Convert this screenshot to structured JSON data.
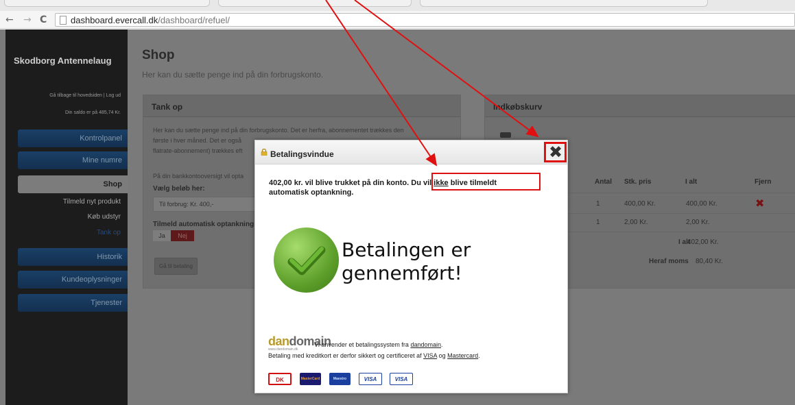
{
  "browser": {
    "url_host": "dashboard.evercall.dk",
    "url_path": "/dashboard/refuel/"
  },
  "sidebar": {
    "site_title": "Skodborg Antennelaug",
    "top_links": "Gå tilbage til hovedsiden | Log ud",
    "balance": "Din saldo er på 485,74 Kr.",
    "items": [
      {
        "label": "Kontrolpanel"
      },
      {
        "label": "Mine numre"
      },
      {
        "label": "Shop"
      },
      {
        "label": "Tilmeld nyt produkt"
      },
      {
        "label": "Køb udstyr"
      },
      {
        "label": "Tank op"
      },
      {
        "label": "Historik"
      },
      {
        "label": "Kundeoplysninger"
      },
      {
        "label": "Tjenester"
      }
    ]
  },
  "main": {
    "title": "Shop",
    "subtitle": "Her kan du sætte penge ind på din forbrugskonto."
  },
  "tank_panel": {
    "title": "Tank op",
    "text_lines": [
      "Her kan du sætte penge ind på din forbrugskonto. Det er herfra, abonnementet trækkes den",
      "første i hver måned. Det er også",
      "flatrate-abonnement) trækkes eft"
    ],
    "bank_text": "På din bankkontooversigt vil opta",
    "amount_label": "Vælg beløb her:",
    "amount_value": "Til forbrug: Kr. 400,-",
    "auto_label": "Tilmeld automatisk optankning",
    "toggle_yes": "Ja",
    "toggle_no": "Nej",
    "pay_button": "Gå til betaling"
  },
  "cart_panel": {
    "title": "Indkøbskurv",
    "columns": [
      "Antal",
      "Stk. pris",
      "I alt",
      "Fjern"
    ],
    "rows": [
      {
        "qty": "1",
        "price": "400,00 Kr.",
        "total": "400,00 Kr."
      },
      {
        "qty": "1",
        "price": "2,00 Kr.",
        "total": "2,00 Kr."
      }
    ],
    "total_label": "I alt",
    "total_value": "402,00 Kr.",
    "vat_label": "Heraf moms",
    "vat_value": "80,40 Kr."
  },
  "modal": {
    "title": "Betalingsvindue",
    "message_part1": "402,00 kr. vil blive trukket på din konto.",
    "message_part2": "Du vil",
    "message_ikke": "ikke",
    "message_part3": "blive tilmeldt",
    "message_line2": "automatisk optankning.",
    "success_line1": "Betalingen er",
    "success_line2": "gennemført!",
    "logo_dan": "dan",
    "logo_domain": "domain",
    "logo_url": "www.dandomain.dk",
    "info1_text": "Vi anvender et betalingssystem fra",
    "info1_link": "dandomain",
    "info1_end": ".",
    "info2_text": "Betaling med kreditkort er derfor sikkert og certificeret af",
    "info2_visa": "VISA",
    "info2_og": "og",
    "info2_mc": "Mastercard",
    "info2_end": ".",
    "cards": [
      "DK",
      "MasterCard",
      "Maestro",
      "VISA",
      "VISA"
    ]
  },
  "colors": {
    "annotation_red": "#e01010",
    "sidebar_blue": "#1a3f66"
  }
}
